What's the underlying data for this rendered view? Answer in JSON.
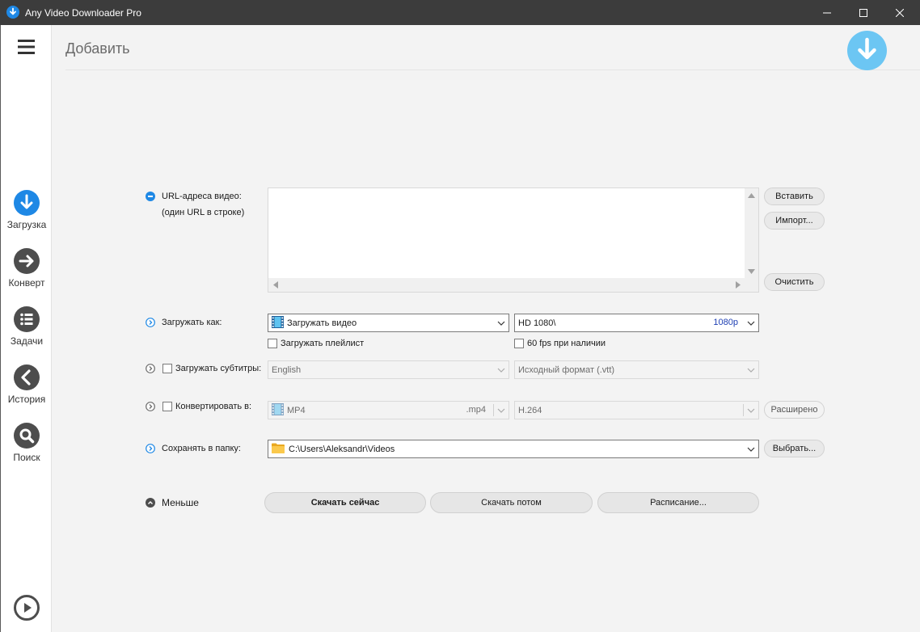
{
  "window": {
    "title": "Any Video Downloader Pro"
  },
  "sidebar": {
    "items": [
      {
        "label": "Загрузка",
        "icon": "download-circle-icon",
        "color": "#1e88e5"
      },
      {
        "label": "Конверт",
        "icon": "arrow-right-circle-icon",
        "color": "#4d4d4d"
      },
      {
        "label": "Задачи",
        "icon": "list-circle-icon",
        "color": "#4d4d4d"
      },
      {
        "label": "История",
        "icon": "back-circle-icon",
        "color": "#4d4d4d"
      },
      {
        "label": "Поиск",
        "icon": "search-circle-icon",
        "color": "#4d4d4d"
      }
    ]
  },
  "header": {
    "title": "Добавить",
    "accent": "#6cc6f3"
  },
  "url_section": {
    "label_line1": "URL-адреса видео:",
    "label_line2": "(один URL в строке)",
    "textarea_value": "",
    "paste_button": "Вставить",
    "import_button": "Импорт...",
    "clear_button": "Очистить"
  },
  "download_as": {
    "label": "Загружать как:",
    "type_value": "Загружать видео",
    "quality_value": "HD 1080\\",
    "quality_tag": "1080p",
    "playlist_label": "Загружать плейлист",
    "playlist_checked": false,
    "fps_label": "60 fps при наличии",
    "fps_checked": false
  },
  "subtitles": {
    "label": "Загружать субтитры:",
    "checked": false,
    "language_value": "English",
    "format_value": "Исходный формат (.vtt)"
  },
  "convert": {
    "label": "Конвертировать в:",
    "checked": false,
    "format_value": "MP4",
    "format_ext": ".mp4",
    "codec_value": "H.264",
    "advanced_button": "Расширено"
  },
  "save_folder": {
    "label": "Сохранять в папку:",
    "path_value": "C:\\Users\\Aleksandr\\Videos",
    "browse_button": "Выбрать..."
  },
  "actions": {
    "less_label": "Меньше",
    "download_now": "Скачать сейчас",
    "download_later": "Скачать потом",
    "schedule": "Расписание..."
  }
}
